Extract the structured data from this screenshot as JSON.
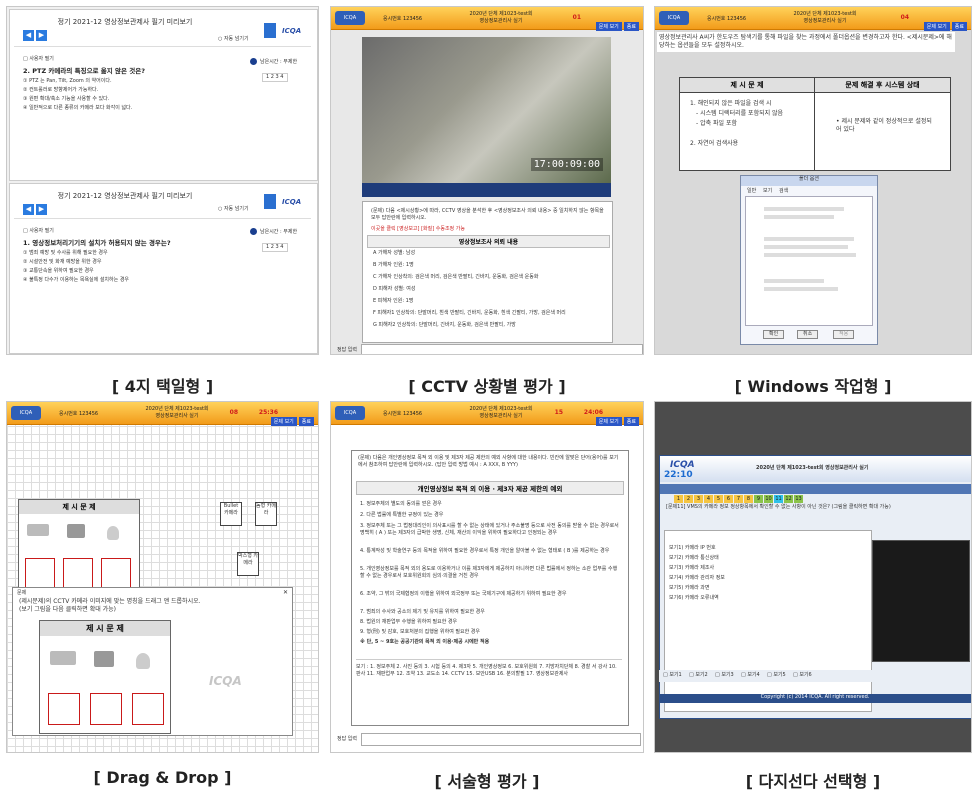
{
  "captions": {
    "p1": "[ 4지 택일형 ]",
    "p2": "[ CCTV 상황별 평가 ]",
    "p3": "[ Windows 작업형 ]",
    "p4": "[ Drag & Drop ]",
    "p5": "[ 서술형 평가 ]",
    "p6": "[ 다지선다 선택형 ]"
  },
  "common": {
    "exam_title_line1": "2020년 단체 제1023-test회",
    "exam_title_line2": "영상정보관리사 실기",
    "id_label": "응시번호 123456",
    "btn_a": "문제 보기",
    "btn_b": "종료"
  },
  "p1": {
    "q1": {
      "title": "정기 2021-12 영상정보관제사 필기 미리보기",
      "answer_toggle": "○ 자동 넘기기",
      "time_label": "남은시간 : 무제한",
      "small_tag": "□ 사용자 필기",
      "question": "2. PTZ 카메라의 특징으로 옳지 않은 것은?",
      "options": [
        "① PTZ 는 Pan, Tilt, Zoom 의 약어이다.",
        "② 컨트롤러로 방향제어가 가능하다.",
        "③ 원편 확대/축소 기능을 사용할 수 있다.",
        "④ 일반적으로 다른 종류의 카메라 보다 화각이 넓다."
      ],
      "pager": "1  2  3  4"
    },
    "q2": {
      "title": "정기 2021-12 영상정보관제사 필기 미리보기",
      "answer_toggle": "○ 자동 넘기기",
      "time_label": "남은시간 : 무제한",
      "small_tag": "□ 사용자 필기",
      "question": "1. 영상정보처리기기의 설치가 허용되지 않는 경우는?",
      "options": [
        "① 범죄 예방 및 수사를 위해 필요한 경우",
        "② 시설안전 및 화재 예방을 위한 경우",
        "③ 교통단속을 위하여 필요한 경우",
        "④ 불특정 다수가 이용하는 목욕실에 설치하는 경우"
      ],
      "pager": "1  2  3  4"
    }
  },
  "p2": {
    "timer": "01",
    "video_time": "17:00:09:00",
    "question": "(문제) 다음 <제시상황>에 따라, CCTV 영상을 분석한 후 <영상정보조사 의뢰 내용> 중 일치하지 않는 항목을 모두 답안란에 입력하시오.",
    "notice": "이곳을 클릭 [영상보고] [화질] 수동조정 가능",
    "table_title": "영상정보조사 의뢰 내용",
    "rows": [
      "A 가해자 성별: 남성",
      "B 가해자 인원: 1명",
      "C 가해자 인상착의: 검은색 머리, 검은색 반팔티, 긴바지, 운동화, 검은색 운동화",
      "D 피해자 성별: 여성",
      "E 피해자 인원: 1명",
      "F 피해자1 인상착의: 단발머리, 흰색 반팔티, 긴바지, 운동화, 흰색 긴팔티, 가방, 검은색 머리",
      "G 피해자2 인상착의: 단발머리, 긴바지, 운동화, 검은색 반팔티, 가방"
    ],
    "answer_label": "정답 입력"
  },
  "p3": {
    "timer": "04",
    "question": "영상정보관리사 A씨가 한도우즈 탐색기를 통해 파일을 찾는 과정에서 폴더옵션을 변경하고자 한다. <제시문제>에 해당하는 옵션들을 모두 설정하시오.",
    "left_head": "제 시 문 제",
    "left_items": [
      "1. 해인되지 않은 파일을 검색 시",
      "- 시스템 디렉터리를 포함되지 않음",
      "- 압축 파일 포함",
      "2. 자연어 검색사용"
    ],
    "right_head": "문제 해결 후 시스템 상태",
    "right_item": "• 제시 문제와 같이 정상적으로 설정되어 있다",
    "dialog_title": "폴더 옵션",
    "dialog_tabs": [
      "일반",
      "보기",
      "검색"
    ],
    "dialog_ok": "확인",
    "dialog_cancel": "취소",
    "dialog_apply": "적용"
  },
  "p4": {
    "timer": "08",
    "time": "25:36",
    "panel_head": "제 시 문 제",
    "labels": [
      "Bullet 카메라",
      "돔형 카메라",
      "박스형 카메라"
    ],
    "popup_title": "문제",
    "popup_text": "(제시문제)의 CCTV 카메라 이미지에 맞는 명칭을 드래그 앤 드롭하시오.",
    "popup_sub": "(보기 그림을 다음 클릭하면 확대 가능)",
    "popup_head": "제 시 문 제",
    "logo": "ICQA"
  },
  "p5": {
    "timer": "15",
    "time": "24:06",
    "question": "(문제) 다음은 개인영상정보 목적 외 이용 및 제3자 제공 제한의 예외 사항에 대한 내용이다. 빈칸에 알맞은 단어(용어)를 보기에서 참조하여 답안란에 입력하시오. (답안 입력 방법 예시 : A XXX, B YYY)",
    "heading": "개인영상정보 목적 외 이용 · 제3자 제공 제한의 예외",
    "items": [
      "1. 정보주체의 별도의 동의를 얻은 경우",
      "2. 다른 법률에 특별한 규정이 있는 경우",
      "3. 정보주체 또는 그 법정대리인이 의사표시를 할 수 없는 상태에 있거나 주소불명 등으로 사전 동의를 받을 수 없는 경우로서 명백히 ( A ) 또는 제3자의 급박한 생명, 신체, 재산의 이익을 위하여 필요하다고 인정되는 경우",
      "4. 통계작성 및 학술연구 등의 목적을 위하여 필요한 경우로서 특정 개인을 알아볼 수 없는 형태로 ( B )를 제공하는 경우",
      "5. 개인영상정보를 목적 외의 용도로 이용하거나 이를 제3자에게 제공하지 아니하면 다른 법률에서 정하는 소관 업무를 수행할 수 없는 경우로서 보호위원회의 심의·의결을 거친 경우",
      "6. 조약, 그 밖의 국제협정의 이행을 위하여 외국정부 또는 국제기구에 제공하기 위하여 필요한 경우",
      "7. 범죄의 수사와 공소의 제기 및 유지를 위하여 필요한 경우",
      "8. 법원의 재판업무 수행을 위하여 필요한 경우",
      "9. 형(刑) 및 감호, 보호처분의 집행을 위하여 필요한 경우",
      "※ 단, 5 ~ 9호는 공공기관의 목적 외 이용·제공 시에만 적용"
    ],
    "choices": "보기 : 1. 정보주체  2. 사진 등의  3. 시험 등의  4. 제3자  5. 개인영상정보  6. 보호위원회  7. 지방자치단체  8. 경찰 서 강사  10. 판사  11. 재판업무  12. 조약  13. 교도소  14. CCTV  15. 보안USB  16. 분의할필  17. 영상정보관제사",
    "answer_label": "정답 입력"
  },
  "p6": {
    "logo": "ICQA",
    "clock": "22:10",
    "title": "2020년 단체 제1023-test회 영상정보관리사 실기",
    "num_buttons": [
      "1",
      "2",
      "3",
      "4",
      "5",
      "6",
      "7",
      "8",
      "9",
      "10",
      "11",
      "12",
      "13"
    ],
    "question": "[문제11]  VMS의 카메라 정보 정상항목에서 확인할 수 없는 사항이 아닌 것은? (그림을 클릭하면 확대 가능)",
    "options": [
      "보기1) 카메라 IP 번호",
      "보기2) 카메라 통신상태",
      "보기3) 카메라 제조사",
      "보기4) 카메라 관리자 정보",
      "보기5) 카메라 과면",
      "보기6) 카메라 오류내역"
    ],
    "checks": [
      "보기1",
      "보기2",
      "보기3",
      "보기4",
      "보기5",
      "보기6"
    ],
    "footer": "Copyright (c) 2014 ICQA. All right reserved."
  }
}
